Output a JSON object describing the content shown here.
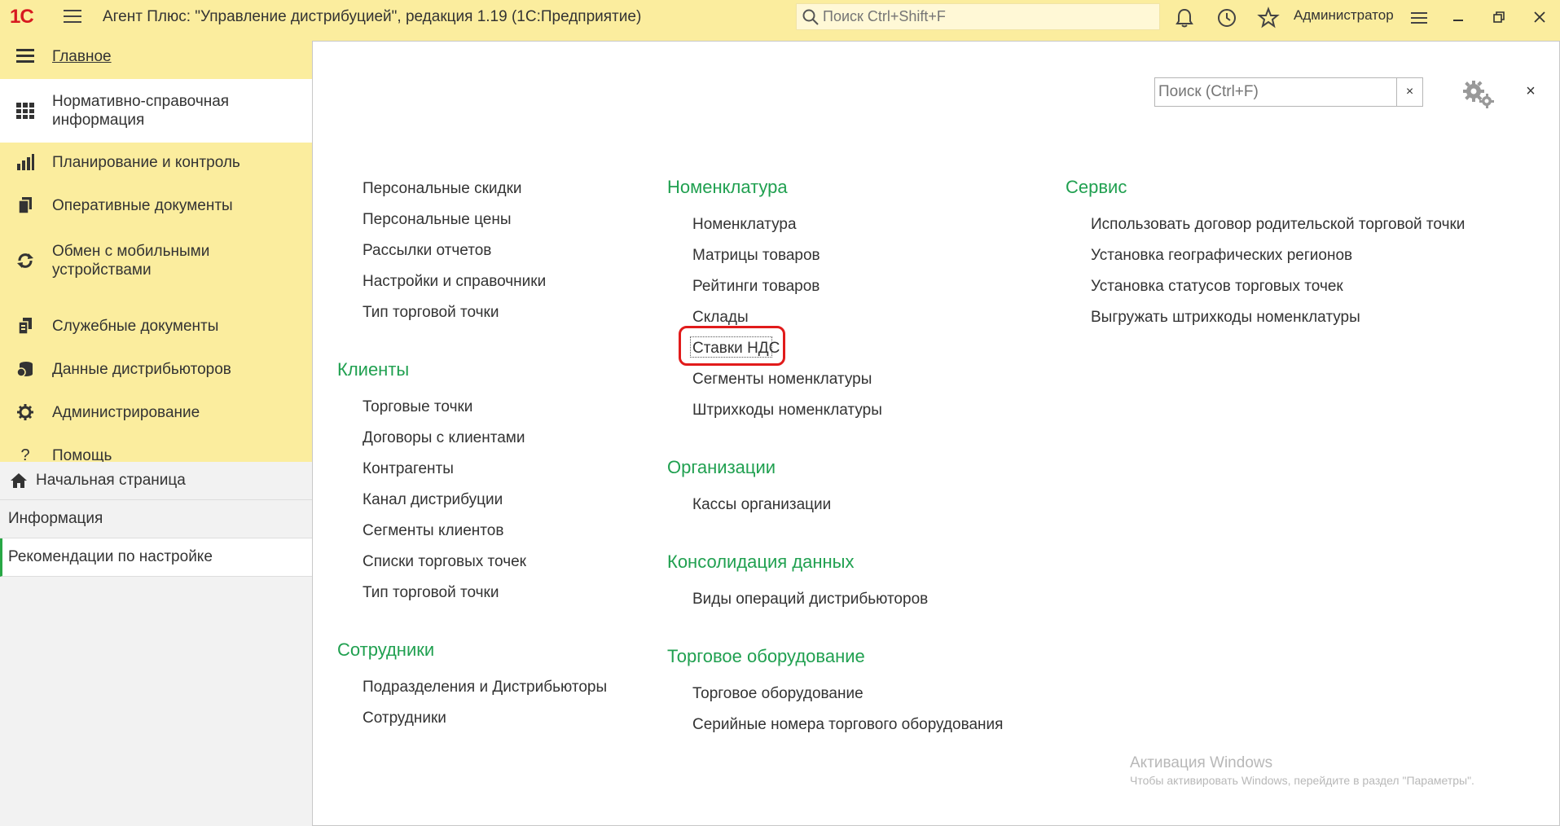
{
  "app": {
    "logo_text": "1С",
    "title": "Агент Плюс: \"Управление дистрибуцией\", редакция 1.19  (1С:Предприятие)",
    "search_placeholder": "Поиск Ctrl+Shift+F",
    "user": "Администратор"
  },
  "sidebar": {
    "items": [
      {
        "label": "Главное",
        "icon": "menu-lines-icon"
      },
      {
        "label": "Нормативно-справочная информация",
        "icon": "table-icon"
      },
      {
        "label": "Планирование и контроль",
        "icon": "chart-icon"
      },
      {
        "label": "Оперативные документы",
        "icon": "documents-icon"
      },
      {
        "label": "Обмен с мобильными устройствами",
        "icon": "sync-icon"
      },
      {
        "label": "Служебные документы",
        "icon": "service-docs-icon"
      },
      {
        "label": "Данные дистрибьюторов",
        "icon": "database-icon"
      },
      {
        "label": "Администрирование",
        "icon": "gear-icon"
      },
      {
        "label": "Помощь",
        "icon": "question-icon"
      }
    ],
    "bottom": [
      {
        "label": "Начальная страница",
        "icon": "home-icon"
      },
      {
        "label": "Информация"
      },
      {
        "label": "Рекомендации по настройке"
      }
    ]
  },
  "content": {
    "search_placeholder": "Поиск (Ctrl+F)",
    "clear_label": "×",
    "close_label": "×",
    "col1": {
      "links_top": [
        "Персональные скидки",
        "Персональные цены",
        "Рассылки отчетов",
        "Настройки и справочники",
        "Тип торговой точки"
      ],
      "groups": [
        {
          "title": "Клиенты",
          "links": [
            "Торговые точки",
            "Договоры с клиентами",
            "Контрагенты",
            "Канал дистрибуции",
            "Сегменты клиентов",
            "Списки торговых точек",
            "Тип торговой точки"
          ]
        },
        {
          "title": "Сотрудники",
          "links": [
            "Подразделения и Дистрибьюторы",
            "Сотрудники"
          ]
        }
      ]
    },
    "col2": {
      "groups": [
        {
          "title": "Номенклатура",
          "links": [
            "Номенклатура",
            "Матрицы товаров",
            "Рейтинги товаров",
            "Склады",
            "Ставки НДС",
            "Сегменты номенклатуры",
            "Штрихкоды номенклатуры"
          ]
        },
        {
          "title": "Организации",
          "links": [
            "Кассы организации"
          ]
        },
        {
          "title": "Консолидация данных",
          "links": [
            "Виды операций дистрибьюторов"
          ]
        },
        {
          "title": "Торговое оборудование",
          "links": [
            "Торговое оборудование",
            "Серийные номера торгового оборудования"
          ]
        }
      ]
    },
    "col3": {
      "groups": [
        {
          "title": "Сервис",
          "links": [
            "Использовать договор родительской торговой точки",
            "Установка географических регионов",
            "Установка статусов торговых точек",
            "Выгружать штрихкоды номенклатуры"
          ]
        }
      ]
    }
  },
  "watermark": {
    "line1": "Активация Windows",
    "line2": "Чтобы активировать Windows, перейдите в раздел \"Параметры\"."
  }
}
